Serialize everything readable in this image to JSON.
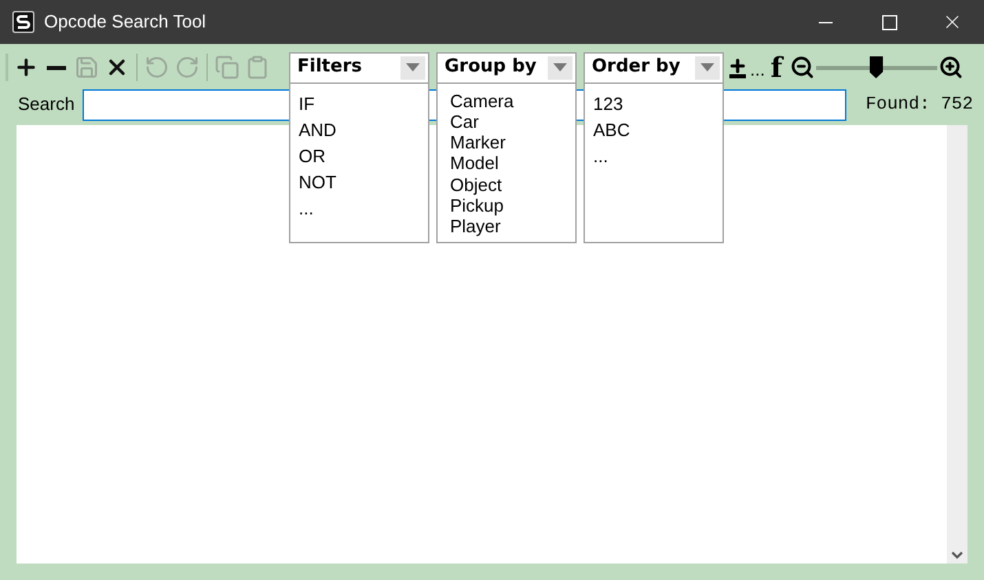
{
  "window": {
    "title": "Opcode Search Tool"
  },
  "toolbar": {
    "buttons": [
      {
        "kind": "add",
        "disabled": false
      },
      {
        "kind": "remove",
        "disabled": false
      },
      {
        "kind": "save",
        "disabled": true
      },
      {
        "kind": "delete",
        "disabled": false
      },
      {
        "kind": "sep"
      },
      {
        "kind": "undo",
        "disabled": true
      },
      {
        "kind": "redo",
        "disabled": true
      },
      {
        "kind": "sep"
      },
      {
        "kind": "copy",
        "disabled": true
      },
      {
        "kind": "paste",
        "disabled": true
      }
    ],
    "dropdowns": [
      {
        "label": "Filters",
        "expanded": true,
        "options": [
          "IF",
          "AND",
          "OR",
          "NOT",
          "..."
        ]
      },
      {
        "label": "Group by",
        "expanded": true,
        "options": [
          "Camera",
          "Car",
          "Marker",
          "Model",
          "Object",
          "Pickup",
          "Player"
        ]
      },
      {
        "label": "Order by",
        "expanded": true,
        "options": [
          "123",
          "ABC",
          "..."
        ]
      }
    ],
    "more": "...",
    "font_button": "f",
    "zoom": {
      "level": 0.49
    }
  },
  "search": {
    "label": "Search",
    "found": "Found: 752"
  }
}
